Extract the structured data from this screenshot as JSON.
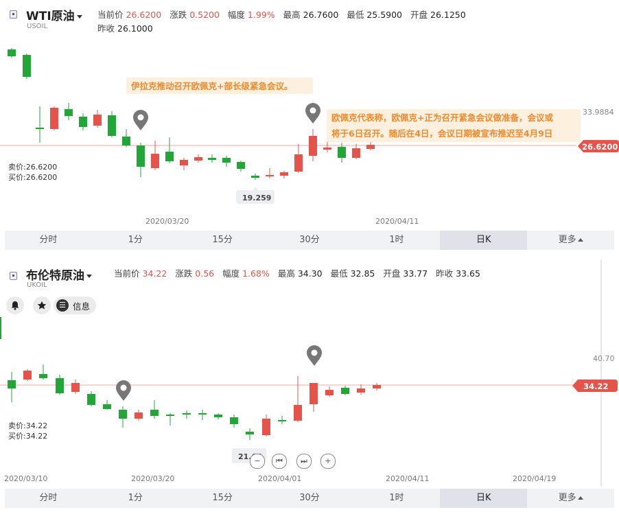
{
  "wti": {
    "name": "WTI原油",
    "code": "USOIL",
    "current_label": "当前价",
    "current": "26.6200",
    "change_label": "涨跌",
    "change": "0.5200",
    "range_label": "幅度",
    "range": "1.99%",
    "high_label": "最高",
    "high": "26.7600",
    "low_label": "最低",
    "low": "25.5900",
    "open_label": "开盘",
    "open": "26.1250",
    "prev_label": "昨收",
    "prev": "26.1000",
    "note1": "伊拉克推动召开欧佩克+部长级紧急会议。",
    "note2_line1": "欧佩克代表称，欧佩克+正为召开紧急会议做准备，会议或",
    "note2_line2": "将于6日召开。随后在4日，会议日期被宣布推迟至4月9日",
    "ask": "卖价:26.6200",
    "bid": "买价:26.6200",
    "top_price": "33.9884",
    "price_tag": "26.6200",
    "low_tag": "19.259",
    "dates": [
      "2020/03/20",
      "2020/04/11"
    ],
    "colors": {
      "up": "#e5544b",
      "down": "#22a638"
    }
  },
  "brent": {
    "name": "布伦特原油",
    "code": "UKOIL",
    "current_label": "当前价",
    "current": "34.22",
    "change_label": "涨跌",
    "change": "0.56",
    "range_label": "幅度",
    "range": "1.68%",
    "high_label": "最高",
    "high": "34.30",
    "low_label": "最低",
    "low": "32.85",
    "open_label": "开盘",
    "open": "33.77",
    "prev_label": "昨收",
    "prev": "33.65",
    "info_label": "信息",
    "ask": "卖价:34.22",
    "bid": "买价:34.22",
    "top_price": "40.70",
    "price_tag": "34.22",
    "low_tag": "21.64",
    "dates": [
      "2020/03/10",
      "2020/03/20",
      "2020/04/01",
      "2020/04/11",
      "2020/04/19"
    ]
  },
  "timeframes": [
    "分时",
    "1分",
    "15分",
    "30分",
    "1时",
    "日K",
    "更多"
  ],
  "active_timeframe": "日K",
  "icons": [
    "bell-icon",
    "star-icon",
    "menu-icon",
    "map-pin-icon",
    "minus-icon",
    "prev-icon",
    "next-icon",
    "plus-icon"
  ]
}
